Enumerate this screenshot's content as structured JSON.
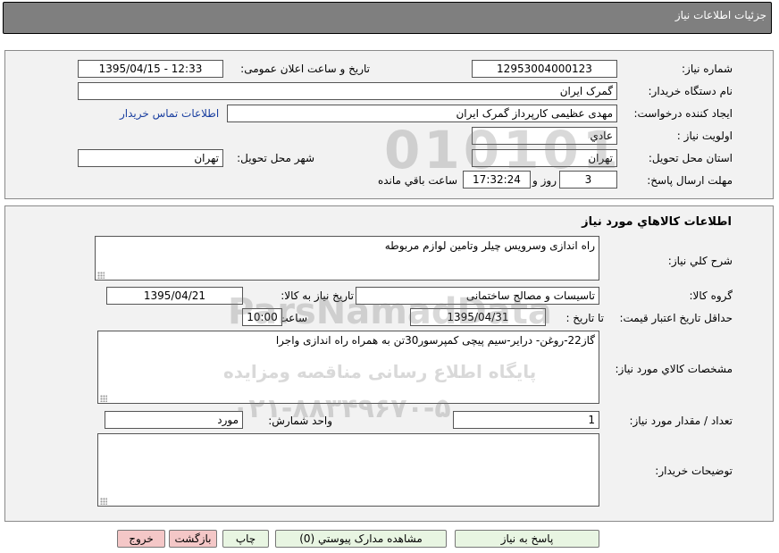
{
  "header": {
    "title": "جزئیات اطلاعات نیاز"
  },
  "need": {
    "number_label": "شماره نیاز:",
    "number_value": "12953004000123",
    "announce_label": "تاریخ و ساعت اعلان عمومی:",
    "announce_value": "1395/04/15 - 12:33",
    "buyer_label": "نام دستگاه خریدار:",
    "buyer_value": "گمرک ایران",
    "creator_label": "ایجاد کننده درخواست:",
    "creator_value": "مهدی عظیمی کارپرداز گمرک ایران",
    "contact_link": "اطلاعات تماس خریدار",
    "priority_label": "اولویت نیاز :",
    "priority_value": "عادي",
    "province_label": "استان محل تحویل:",
    "province_value": "تهران",
    "city_label": "شهر محل تحویل:",
    "city_value": "تهران",
    "deadline_label": "مهلت ارسال پاسخ:",
    "deadline_days": "3",
    "days_word": "روز و",
    "deadline_time": "17:32:24",
    "remaining_text": "ساعت باقي مانده"
  },
  "goods": {
    "section_title": "اطلاعات کالاهاي مورد نياز",
    "desc_label": "شرح کلي نياز:",
    "desc_value": "راه اندازی وسرویس چیلر وتامین لوازم مربوطه",
    "group_label": "گروه کالا:",
    "group_value": "تاسیسات و مصالح ساختمانی",
    "need_date_label": "تاریخ نیاز به کالا:",
    "need_date_value": "1395/04/21",
    "validity_label": "حداقل تاریخ اعتبار قیمت:",
    "to_date_label": "تا تاریخ :",
    "to_date_value": "1395/04/31",
    "time_label": "ساعت :",
    "time_value": "10:00",
    "spec_label": "مشخصات کالاي مورد نياز:",
    "spec_value": "گاز22-روغن- درایر-سیم پیچی کمپرسور30تن به همراه راه اندازی واجرا",
    "qty_label": "تعداد / مقدار مورد نیاز:",
    "qty_value": "1",
    "unit_label": "واحد شمارش:",
    "unit_value": "مورد",
    "buyer_notes_label": "توضیحات خریدار:",
    "buyer_notes_value": ""
  },
  "buttons": {
    "reply": "پاسخ به نیاز",
    "attachments": "مشاهده مدارک پیوستي (0)",
    "print": "چاپ",
    "back": "بازگشت",
    "exit": "خروج"
  },
  "watermark": {
    "line1": "ParsNamadData",
    "line2": "پایگاه اطلاع رسانی مناقصه ومزایده",
    "line3": "۰۲۱-۸۸۳۴۹۶۷۰-۵",
    "digits": "010101"
  }
}
